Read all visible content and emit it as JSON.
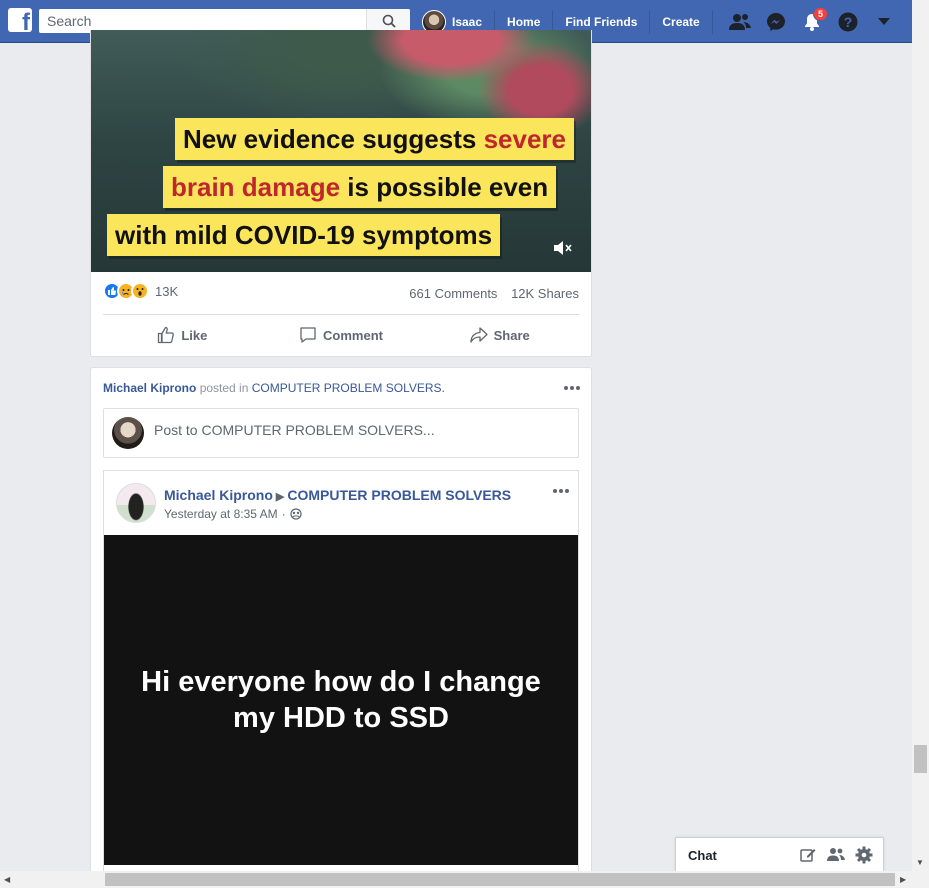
{
  "topbar": {
    "logo": "f",
    "search_placeholder": "Search",
    "profile_name": "Isaac",
    "nav": [
      "Home",
      "Find Friends",
      "Create"
    ],
    "notification_count": "5",
    "icons": [
      "friends-icon",
      "messenger-icon",
      "notifications-icon",
      "help-icon",
      "account-menu-icon"
    ],
    "brand_color": "#4267b2"
  },
  "post1": {
    "caption_lines": [
      {
        "pre": "New evidence suggests ",
        "hl": "severe",
        "post": ""
      },
      {
        "pre": "",
        "hl": "brain damage",
        "post": " is possible even"
      },
      {
        "pre": "with mild COVID-19 symptoms",
        "hl": "",
        "post": ""
      }
    ],
    "reaction_count": "13K",
    "comments": "661 Comments",
    "shares": "12K Shares",
    "actions": {
      "like": "Like",
      "comment": "Comment",
      "share": "Share"
    }
  },
  "post2": {
    "header": {
      "author": "Michael Kiprono",
      "posted_in": "posted in",
      "group": "COMPUTER PROBLEM SOLVERS",
      "period": "."
    },
    "composer_placeholder": "Post to COMPUTER PROBLEM SOLVERS...",
    "shared": {
      "author": "Michael Kiprono",
      "group": "COMPUTER PROBLEM SOLVERS",
      "timestamp": "Yesterday at 8:35 AM",
      "separator": "·",
      "text": "Hi everyone how do I change my HDD to SSD"
    }
  },
  "chat": {
    "label": "Chat"
  }
}
